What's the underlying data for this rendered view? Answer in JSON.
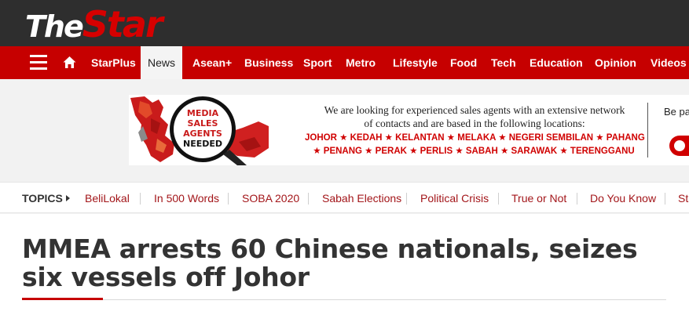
{
  "brand": {
    "logo_the": "The",
    "logo_star": "Star"
  },
  "nav": {
    "items": [
      {
        "label": "StarPlus"
      },
      {
        "label": "News"
      },
      {
        "label": "Asean+"
      },
      {
        "label": "Business"
      },
      {
        "label": "Sport"
      },
      {
        "label": "Metro"
      },
      {
        "label": "Lifestyle"
      },
      {
        "label": "Food"
      },
      {
        "label": "Tech"
      },
      {
        "label": "Education"
      },
      {
        "label": "Opinion"
      },
      {
        "label": "Videos"
      }
    ],
    "active": "News"
  },
  "ad": {
    "badge_lines": [
      "MEDIA",
      "SALES",
      "AGENTS",
      "NEEDED"
    ],
    "line1": "We are looking for experienced sales agents with an extensive network",
    "line2": "of contacts and are based in the following locations:",
    "line3": "JOHOR ★ KEDAH ★ KELANTAN ★ MELAKA  ★ NEGERI SEMBILAN ★ PAHANG",
    "line4": "★ PENANG ★ PERAK ★ PERLIS ★ SABAH ★ SARAWAK ★ TERENGGANU",
    "side_text": "Be pa"
  },
  "topics": {
    "label": "TOPICS",
    "items": [
      "BeliLokal",
      "In 500 Words",
      "SOBA 2020",
      "Sabah Elections",
      "Political Crisis",
      "True or Not",
      "Do You Know",
      "Sta"
    ]
  },
  "article": {
    "headline": "MMEA arrests 60 Chinese nationals, seizes six vessels off Johor"
  },
  "colors": {
    "brand_red": "#c60000",
    "dark": "#2e2e2e",
    "topic_red": "#a3161a"
  },
  "icons": {
    "menu": "hamburger-icon",
    "home": "home-icon",
    "topics_arrow": "triangle-right-icon"
  }
}
